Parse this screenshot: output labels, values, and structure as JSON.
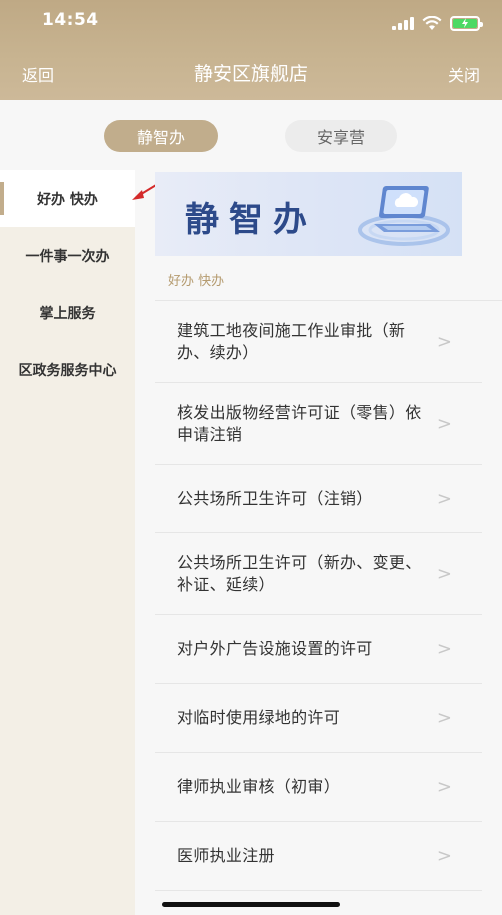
{
  "status_bar": {
    "time": "14:54"
  },
  "nav": {
    "back_label": "返回",
    "title": "静安区旗舰店",
    "close_label": "关闭"
  },
  "tabs": [
    {
      "label": "静智办",
      "active": true
    },
    {
      "label": "安享营",
      "active": false
    }
  ],
  "sidebar": {
    "items": [
      {
        "label": "好办 快办",
        "active": true
      },
      {
        "label": "一件事一次办",
        "active": false
      },
      {
        "label": "掌上服务",
        "active": false
      },
      {
        "label": "区政务服务中心",
        "active": false
      }
    ]
  },
  "banner": {
    "text": "静智办"
  },
  "section": {
    "title": "好办 快办"
  },
  "services": [
    {
      "label": "建筑工地夜间施工作业审批（新办、续办）"
    },
    {
      "label": "核发出版物经营许可证（零售）依申请注销"
    },
    {
      "label": "公共场所卫生许可（注销）"
    },
    {
      "label": "公共场所卫生许可（新办、变更、补证、延续）"
    },
    {
      "label": "对户外广告设施设置的许可"
    },
    {
      "label": "对临时使用绿地的许可"
    },
    {
      "label": "律师执业审核（初审）"
    },
    {
      "label": "医师执业注册"
    }
  ],
  "chevron_glyph": ">",
  "colors": {
    "header_gold": "#c7b390",
    "accent_gold": "#c1ad8c",
    "sidebar_bg": "#f3efe6",
    "annotation_red": "#d42a2a"
  },
  "icons": [
    "signal-icon",
    "wifi-icon",
    "battery-icon",
    "laptop-cloud-icon",
    "chevron-right-icon",
    "annotation-arrow"
  ]
}
